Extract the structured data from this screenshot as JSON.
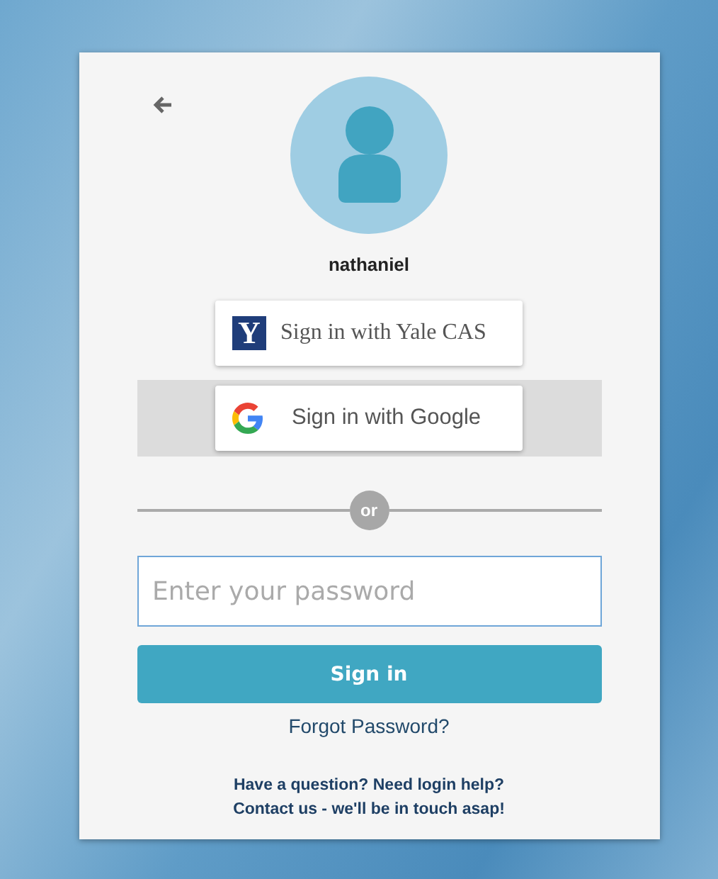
{
  "username": "nathaniel",
  "providers": [
    {
      "kind": "yale",
      "logo_text": "Y",
      "label": "Sign in with Yale CAS",
      "highlighted": false
    },
    {
      "kind": "google",
      "label": "Sign in with Google",
      "highlighted": true
    }
  ],
  "divider": "or",
  "password": {
    "placeholder": "Enter your password"
  },
  "submit": "Sign in",
  "forgot_link": "Forgot Password?",
  "help": [
    "Have a question? Need login help?",
    "Contact us - we'll be in touch asap!"
  ]
}
